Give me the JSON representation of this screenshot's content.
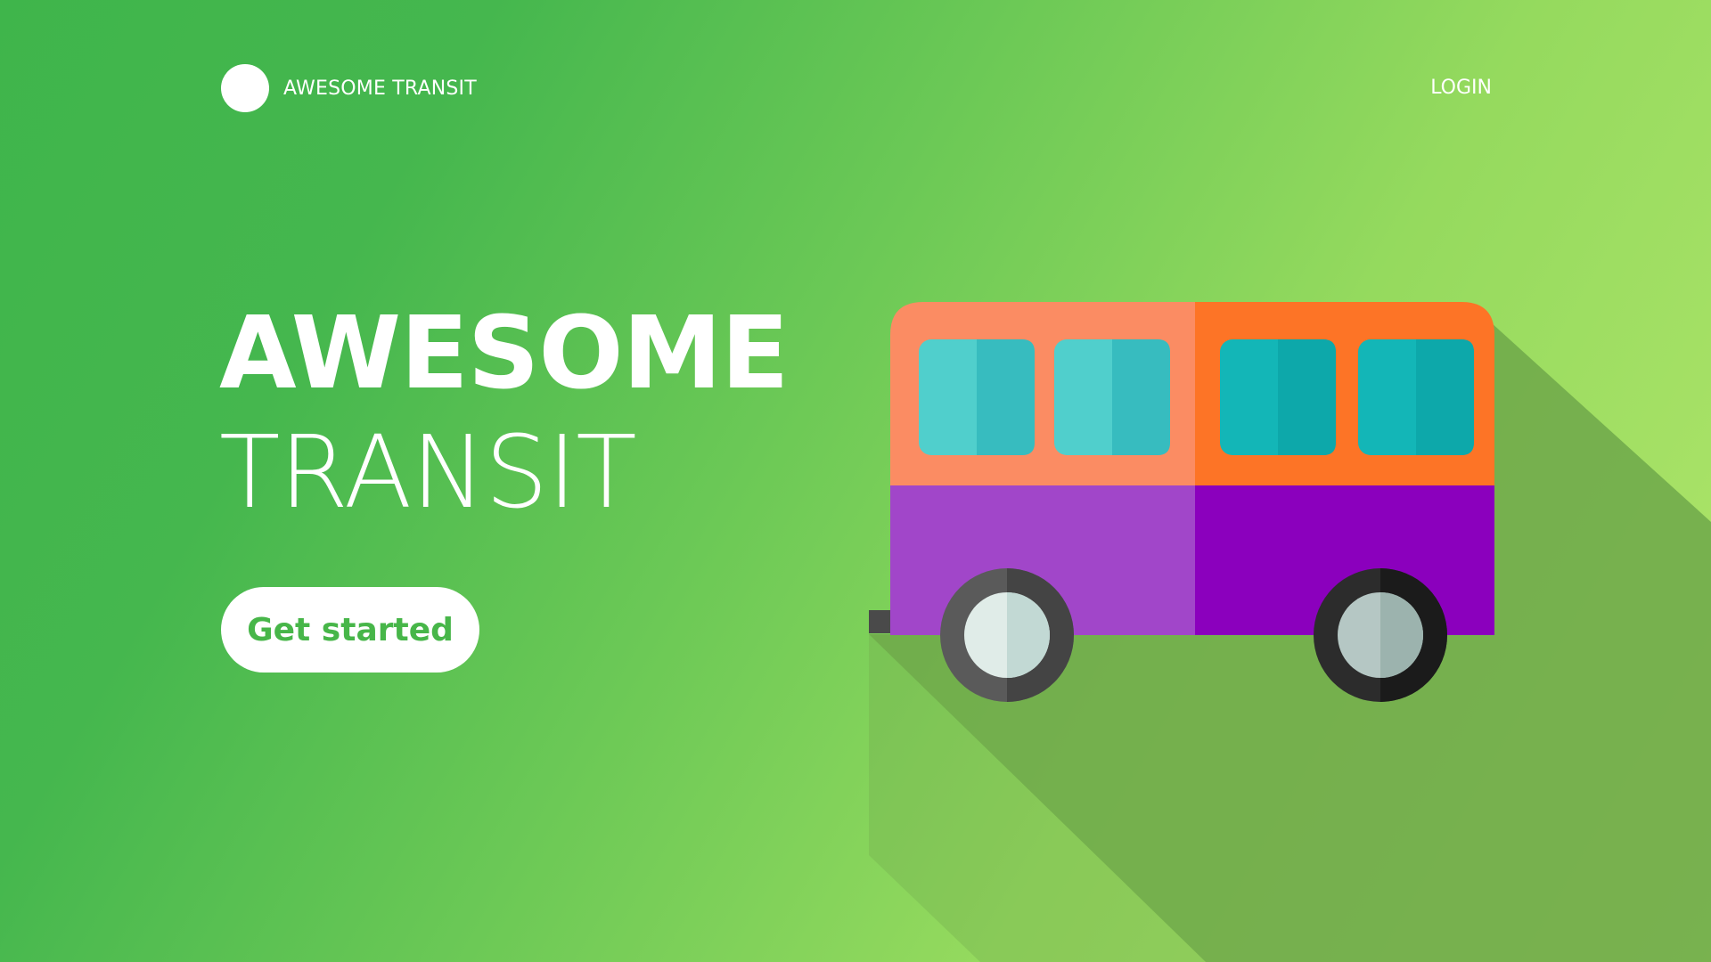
{
  "brand": {
    "name": "AWESOME TRANSIT",
    "logo_icon": "circle-logo-icon"
  },
  "nav": {
    "login_label": "LOGIN"
  },
  "hero": {
    "title_line1": "AWESOME",
    "title_line2": "TRANSIT",
    "cta_label": "Get started"
  },
  "illustration": {
    "subject": "bus-icon",
    "colors": {
      "background_start": "#3fb54b",
      "background_end": "#b2e66b",
      "bus_roof_light": "#fb8c63",
      "bus_roof_dark": "#fd7426",
      "bus_body_light": "#a146c9",
      "bus_body_dark": "#8b00bd",
      "window_light": "#50cfcc",
      "window_dark": "#0fb3b5",
      "shadow": "#6fa84a"
    }
  }
}
